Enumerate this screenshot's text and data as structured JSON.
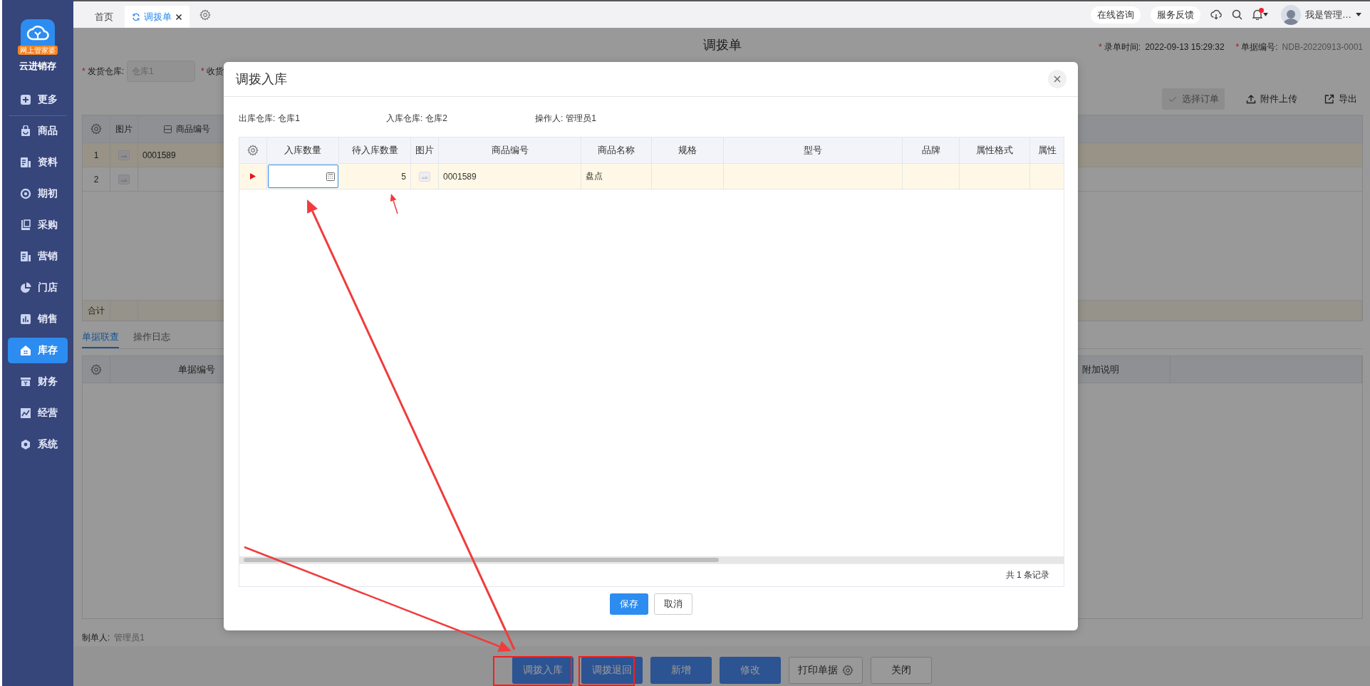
{
  "sidebar": {
    "logo_badge": "网上管家婆",
    "app_name": "云进销存",
    "items": [
      {
        "label": "更多",
        "selected": false
      },
      {
        "label": "商品",
        "selected": false
      },
      {
        "label": "资料",
        "selected": false
      },
      {
        "label": "期初",
        "selected": false
      },
      {
        "label": "采购",
        "selected": false
      },
      {
        "label": "营销",
        "selected": false
      },
      {
        "label": "门店",
        "selected": false
      },
      {
        "label": "销售",
        "selected": false
      },
      {
        "label": "库存",
        "selected": true
      },
      {
        "label": "财务",
        "selected": false
      },
      {
        "label": "经营",
        "selected": false
      },
      {
        "label": "系统",
        "selected": false
      }
    ]
  },
  "topbar": {
    "tabs": [
      {
        "label": "首页",
        "selected": false,
        "closable": false
      },
      {
        "label": "调拨单",
        "selected": true,
        "closable": true
      }
    ],
    "links": [
      "在线咨询",
      "服务反馈"
    ],
    "has_notification": true,
    "user": "我是管理…"
  },
  "document": {
    "title": "调拨单",
    "meta": [
      {
        "mark": "*",
        "label": "录单时间:",
        "value": "2022-09-13 15:29:32"
      },
      {
        "mark": "*",
        "label": "单据编号:",
        "value": "NDB-20220913-0001"
      }
    ],
    "fields": [
      {
        "mark": "*",
        "label": "发货仓库:",
        "value": "仓库1"
      },
      {
        "mark": "*",
        "label": "收货"
      }
    ],
    "toolbar": [
      {
        "label": "选择订单",
        "disabled": true
      },
      {
        "label": "附件上传",
        "disabled": false
      },
      {
        "label": "导出",
        "disabled": false
      }
    ],
    "grid": {
      "columns": [
        "图片",
        "商品编号"
      ],
      "rows": [
        {
          "no": "1",
          "code": "0001589",
          "selected": true
        },
        {
          "no": "2",
          "selected": false
        }
      ],
      "total_label": "合计"
    },
    "subtabs": [
      {
        "label": "单据联查",
        "selected": true
      },
      {
        "label": "操作日志",
        "selected": false
      }
    ],
    "link_grid": {
      "columns": [
        "单据编号",
        "附加说明"
      ]
    },
    "creator": {
      "label": "制单人:",
      "value": "管理员1"
    },
    "actions": [
      {
        "label": "调拨入库",
        "kind": "primary"
      },
      {
        "label": "调拨退回",
        "kind": "primary"
      },
      {
        "label": "新增",
        "kind": "primary"
      },
      {
        "label": "修改",
        "kind": "primary"
      },
      {
        "label": "打印单据",
        "kind": "settings"
      },
      {
        "label": "关闭",
        "kind": "default"
      }
    ]
  },
  "dialog": {
    "title": "调拨入库",
    "info": [
      {
        "label": "出库仓库:",
        "value": "仓库1"
      },
      {
        "label": "入库仓库:",
        "value": "仓库2"
      },
      {
        "label": "操作人:",
        "value": "管理员1"
      }
    ],
    "columns": [
      "入库数量",
      "待入库数量",
      "图片",
      "商品编号",
      "商品名称",
      "规格",
      "型号",
      "品牌",
      "属性格式",
      "属性"
    ],
    "rows": [
      {
        "selected": true,
        "pending": "5",
        "code": "0001589",
        "name": "盘点"
      }
    ],
    "footer": "共 1 条记录",
    "buttons": [
      {
        "label": "保存",
        "kind": "primary"
      },
      {
        "label": "取消",
        "kind": "default"
      }
    ]
  }
}
